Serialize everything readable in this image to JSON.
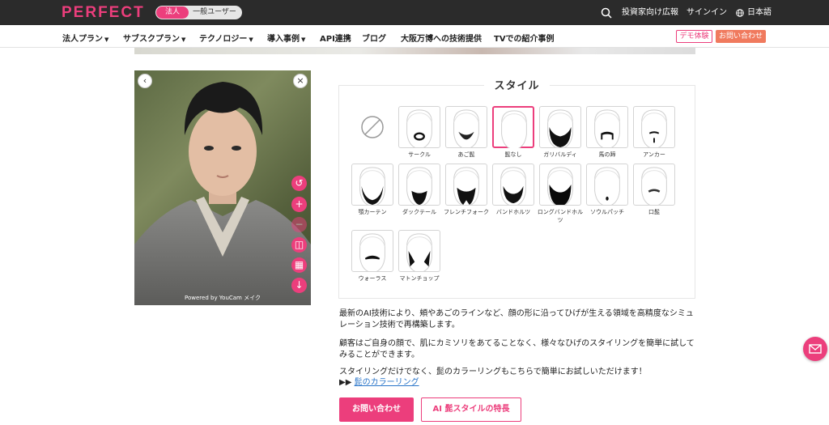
{
  "header": {
    "logo": "PERFECT",
    "toggle": {
      "active": "法人",
      "inactive": "一般ユーザー"
    },
    "investor_link": "投資家向け広報",
    "signin": "サインイン",
    "language": "日本語"
  },
  "nav": {
    "items": [
      {
        "label": "法人プラン",
        "caret": true
      },
      {
        "label": "サブスクプラン",
        "caret": true
      },
      {
        "label": "テクノロジー",
        "caret": true
      },
      {
        "label": "導入事例",
        "caret": true
      },
      {
        "label": "API連携",
        "caret": false
      },
      {
        "label": "ブログ",
        "caret": false
      },
      {
        "label": "大阪万博への技術提供",
        "caret": false
      },
      {
        "label": "TVでの紹介事例",
        "caret": false
      }
    ],
    "demo_label": "デモ体験",
    "contact_label": "お問い合わせ"
  },
  "photo": {
    "powered_by": "Powered by YouCam メイク"
  },
  "style_panel": {
    "title": "スタイル",
    "styles": [
      {
        "label": "サークル",
        "selected": false
      },
      {
        "label": "あご髭",
        "selected": false
      },
      {
        "label": "髭なし",
        "selected": true
      },
      {
        "label": "ガリバルディ",
        "selected": false
      },
      {
        "label": "馬の蹄",
        "selected": false
      },
      {
        "label": "アンカー",
        "selected": false
      },
      {
        "label": "顎カーテン",
        "selected": false
      },
      {
        "label": "ダックテール",
        "selected": false
      },
      {
        "label": "フレンチフォーク",
        "selected": false
      },
      {
        "label": "バンドホルツ",
        "selected": false
      },
      {
        "label": "ロングバンドホルツ",
        "selected": false
      },
      {
        "label": "ソウルパッチ",
        "selected": false
      },
      {
        "label": "口髭",
        "selected": false
      },
      {
        "label": "ウォーラス",
        "selected": false
      },
      {
        "label": "マトンチョップ",
        "selected": false
      }
    ]
  },
  "description": {
    "p1": "最新のAI技術により、頬やあごのラインなど、顔の形に沿ってひげが生える領域を高精度なシミュレーション技術で再構築します。",
    "p2": "顧客はご自身の顔で、肌にカミソリをあてることなく、様々なひげのスタイリングを簡単に試してみることができます。",
    "p3": "スタイリングだけでなく、髭のカラーリングもこちらで簡単にお試しいただけます！",
    "p3_prefix": "▶▶",
    "p3_link": "髭のカラーリング"
  },
  "cta": {
    "primary": "お問い合わせ",
    "secondary": "AI 髭スタイルの特長"
  },
  "colors": {
    "brand_pink": "#ec3e7c",
    "orange": "#f07a5e",
    "topbar": "#2b2b2b"
  }
}
